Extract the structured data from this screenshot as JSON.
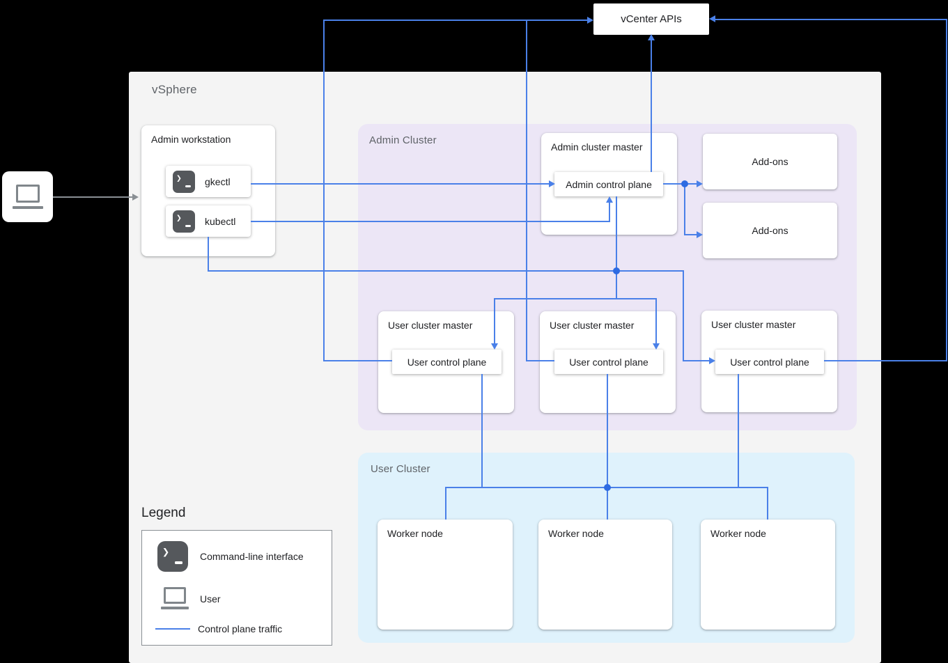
{
  "vcenter": {
    "label": "vCenter APIs"
  },
  "vsphere": {
    "label": "vSphere"
  },
  "admin_workstation": {
    "title": "Admin workstation",
    "tools": [
      {
        "label": "gkectl"
      },
      {
        "label": "kubectl"
      }
    ]
  },
  "admin_cluster": {
    "label": "Admin Cluster",
    "master": {
      "title": "Admin cluster master",
      "control_plane": "Admin control plane"
    },
    "addons": [
      {
        "label": "Add-ons"
      },
      {
        "label": "Add-ons"
      }
    ],
    "user_masters": [
      {
        "title": "User cluster master",
        "control_plane": "User control plane"
      },
      {
        "title": "User cluster master",
        "control_plane": "User control plane"
      },
      {
        "title": "User cluster master",
        "control_plane": "User control plane"
      }
    ]
  },
  "user_cluster": {
    "label": "User Cluster",
    "workers": [
      {
        "label": "Worker node"
      },
      {
        "label": "Worker node"
      },
      {
        "label": "Worker node"
      }
    ]
  },
  "legend": {
    "title": "Legend",
    "items": [
      {
        "icon": "terminal-icon",
        "label": "Command-line interface"
      },
      {
        "icon": "laptop-icon",
        "label": "User"
      },
      {
        "icon": "control-plane-line",
        "label": "Control plane traffic"
      }
    ]
  },
  "colors": {
    "line_blue": "#4a80e8",
    "admin_cluster_fill": "#ece6f6",
    "user_cluster_fill": "#dff2fc",
    "vsphere_fill": "#f4f4f4",
    "terminal_icon_bg": "#55585c",
    "user_icon_gray": "#80868b"
  }
}
